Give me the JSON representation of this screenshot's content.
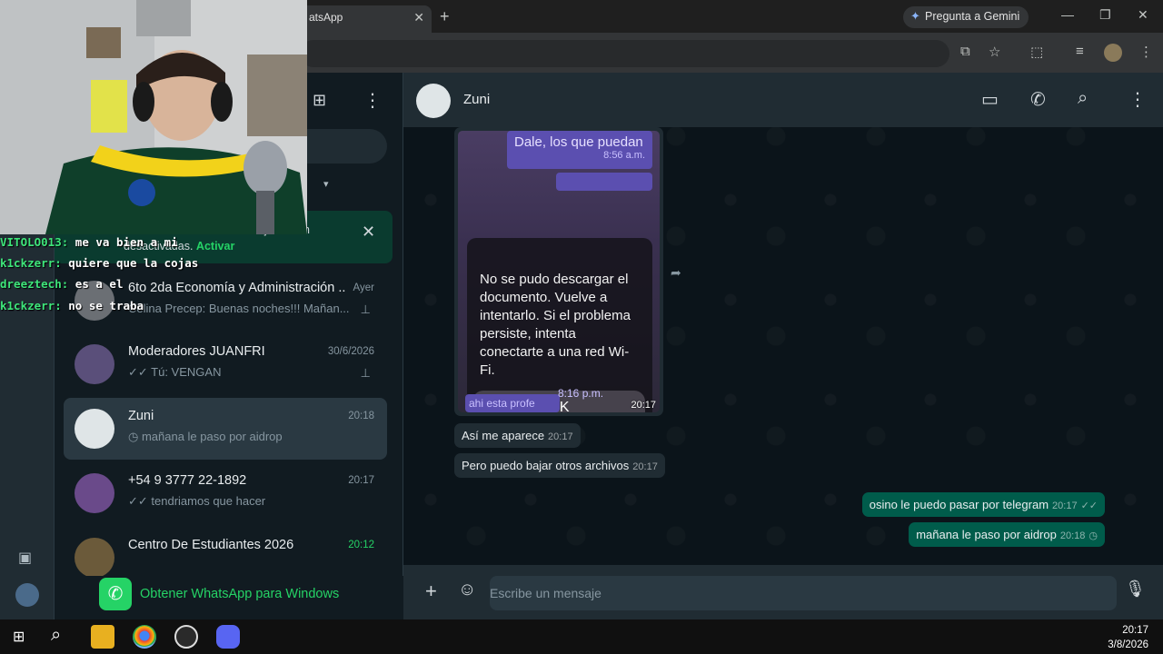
{
  "browser": {
    "tab_title": "atsApp",
    "tab_close": "✕",
    "new_tab": "+",
    "gemini_label": "Pregunta a Gemini"
  },
  "notification_banner": {
    "text_partial": "ás notificac. ones de mensajes están desactivadas.",
    "action": "Activar"
  },
  "chat_list": {
    "items": [
      {
        "name": "6to 2da Economía y Administración ...",
        "time": "Ayer",
        "preview": "Celina Precep: Buenas noches!!! Mañan...",
        "pinned": true,
        "active": false,
        "avatar_color": "#6b6f74"
      },
      {
        "name": "Moderadores JUANFRI",
        "time": "30/6/2026",
        "preview": "✓✓ Tú: VENGAN",
        "pinned": true,
        "active": false,
        "avatar_color": "#5a4f7a"
      },
      {
        "name": "Zuni",
        "time": "20:18",
        "preview": "◷ mañana le paso por aidrop",
        "pinned": false,
        "active": true,
        "avatar_color": "#dfe5e7"
      },
      {
        "name": "+54 9 3777 22-1892",
        "time": "20:17",
        "preview": "✓✓ tendriamos que hacer",
        "pinned": false,
        "active": false,
        "avatar_color": "#6a4a8a"
      },
      {
        "name": "Centro De Estudiantes 2026",
        "time": "20:12",
        "preview": "",
        "pinned": false,
        "active": false,
        "avatar_color": "#6b5a3a",
        "time_color": "#25d366"
      }
    ]
  },
  "banner": {
    "text": "Obtener WhatsApp para Windows"
  },
  "chat": {
    "contact_name": "Zuni",
    "image_message": {
      "top_text": "Dale, los que puedan",
      "top_time": "8:56 a.m.",
      "dialog_text": "No se pudo descargar el documento. Vuelve a intentarlo. Si el problema persiste, intenta conectarte a una red Wi-Fi.",
      "dialog_button": "OK",
      "inner_time": "8:16 p.m.",
      "bottom_text": "ahi esta profe",
      "timestamp": "20:17"
    },
    "messages": [
      {
        "direction": "in",
        "text": "Así me aparece",
        "time": "20:17"
      },
      {
        "direction": "in",
        "text": "Pero puedo bajar otros archivos",
        "time": "20:17"
      },
      {
        "direction": "out",
        "text": "osino le puedo pasar por telegram",
        "time": "20:17",
        "status": "✓✓"
      },
      {
        "direction": "out",
        "text": "mañana le paso por aidrop",
        "time": "20:18",
        "status": "◷"
      }
    ],
    "input_placeholder": "Escribe un mensaje"
  },
  "stream_chat": [
    {
      "user": "VITOLO013:",
      "text": "me va bien a mi"
    },
    {
      "user": "k1ckzerr:",
      "text": "quiere que la cojas"
    },
    {
      "user": "dreeztech:",
      "text": "es a el"
    },
    {
      "user": "k1ckzerr:",
      "text": "no se traba"
    }
  ],
  "taskbar": {
    "time": "20:17",
    "date": "3/8/2026"
  },
  "colors": {
    "accent": "#25d366",
    "bubble_out": "#005c4b",
    "bubble_in": "#202c33",
    "panel": "#111b21"
  }
}
